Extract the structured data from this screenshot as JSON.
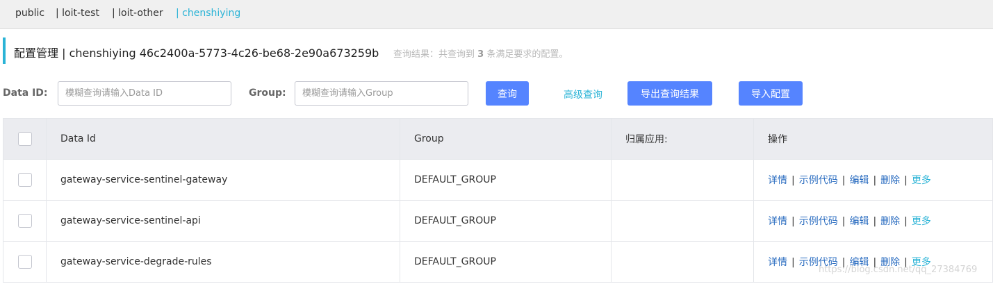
{
  "namespaces": [
    {
      "label": "public",
      "active": false
    },
    {
      "label": "| loit-test",
      "active": false
    },
    {
      "label": "| loit-other",
      "active": false
    },
    {
      "label": "| chenshiying",
      "active": true
    }
  ],
  "page": {
    "title": "配置管理 | chenshiying 46c2400a-5773-4c26-be68-2e90a673259b",
    "result_prefix": "查询结果：共查询到",
    "result_count": "3",
    "result_suffix": "条满足要求的配置。"
  },
  "search": {
    "data_id_label": "Data ID:",
    "data_id_placeholder": "模糊查询请输入Data ID",
    "group_label": "Group:",
    "group_placeholder": "模糊查询请输入Group",
    "query_button": "查询",
    "advanced_query": "高级查询",
    "export_button": "导出查询结果",
    "import_button": "导入配置"
  },
  "table": {
    "columns": [
      "Data Id",
      "Group",
      "归属应用:",
      "操作"
    ],
    "rows": [
      {
        "data_id": "gateway-service-sentinel-gateway",
        "group": "DEFAULT_GROUP",
        "app": ""
      },
      {
        "data_id": "gateway-service-sentinel-api",
        "group": "DEFAULT_GROUP",
        "app": ""
      },
      {
        "data_id": "gateway-service-degrade-rules",
        "group": "DEFAULT_GROUP",
        "app": ""
      }
    ],
    "ops": {
      "detail": "详情",
      "sample_code": "示例代码",
      "edit": "编辑",
      "delete": "删除",
      "more": "更多",
      "separator": "|"
    }
  },
  "watermark": "https://blog.csdn.net/qq_27384769",
  "colors": {
    "accent": "#2ab3d6",
    "primary_button": "#5584ff",
    "link": "#2a6cc0"
  }
}
